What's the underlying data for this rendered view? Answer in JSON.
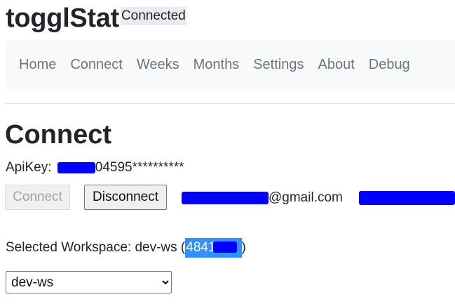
{
  "app": {
    "brand": "togglStat",
    "status": "Connected"
  },
  "nav": {
    "items": [
      {
        "label": "Home"
      },
      {
        "label": "Connect"
      },
      {
        "label": "Weeks"
      },
      {
        "label": "Months"
      },
      {
        "label": "Settings"
      },
      {
        "label": "About"
      },
      {
        "label": "Debug"
      }
    ]
  },
  "page": {
    "title": "Connect"
  },
  "apikey": {
    "label": "ApiKey:",
    "visible_suffix": "04595**********"
  },
  "buttons": {
    "connect_label": "Connect",
    "disconnect_label": "Disconnect"
  },
  "account": {
    "email_visible": "@gmail.com"
  },
  "workspace": {
    "label": "Selected Workspace: dev-ws (",
    "id_visible": "4841",
    "close": ")",
    "selected": "dev-ws",
    "options": [
      "dev-ws"
    ]
  },
  "colors": {
    "redaction": "#0000ff",
    "selection_highlight": "#3390ff",
    "navbar_bg": "#f8f9fa",
    "nav_link": "#6c757d"
  }
}
